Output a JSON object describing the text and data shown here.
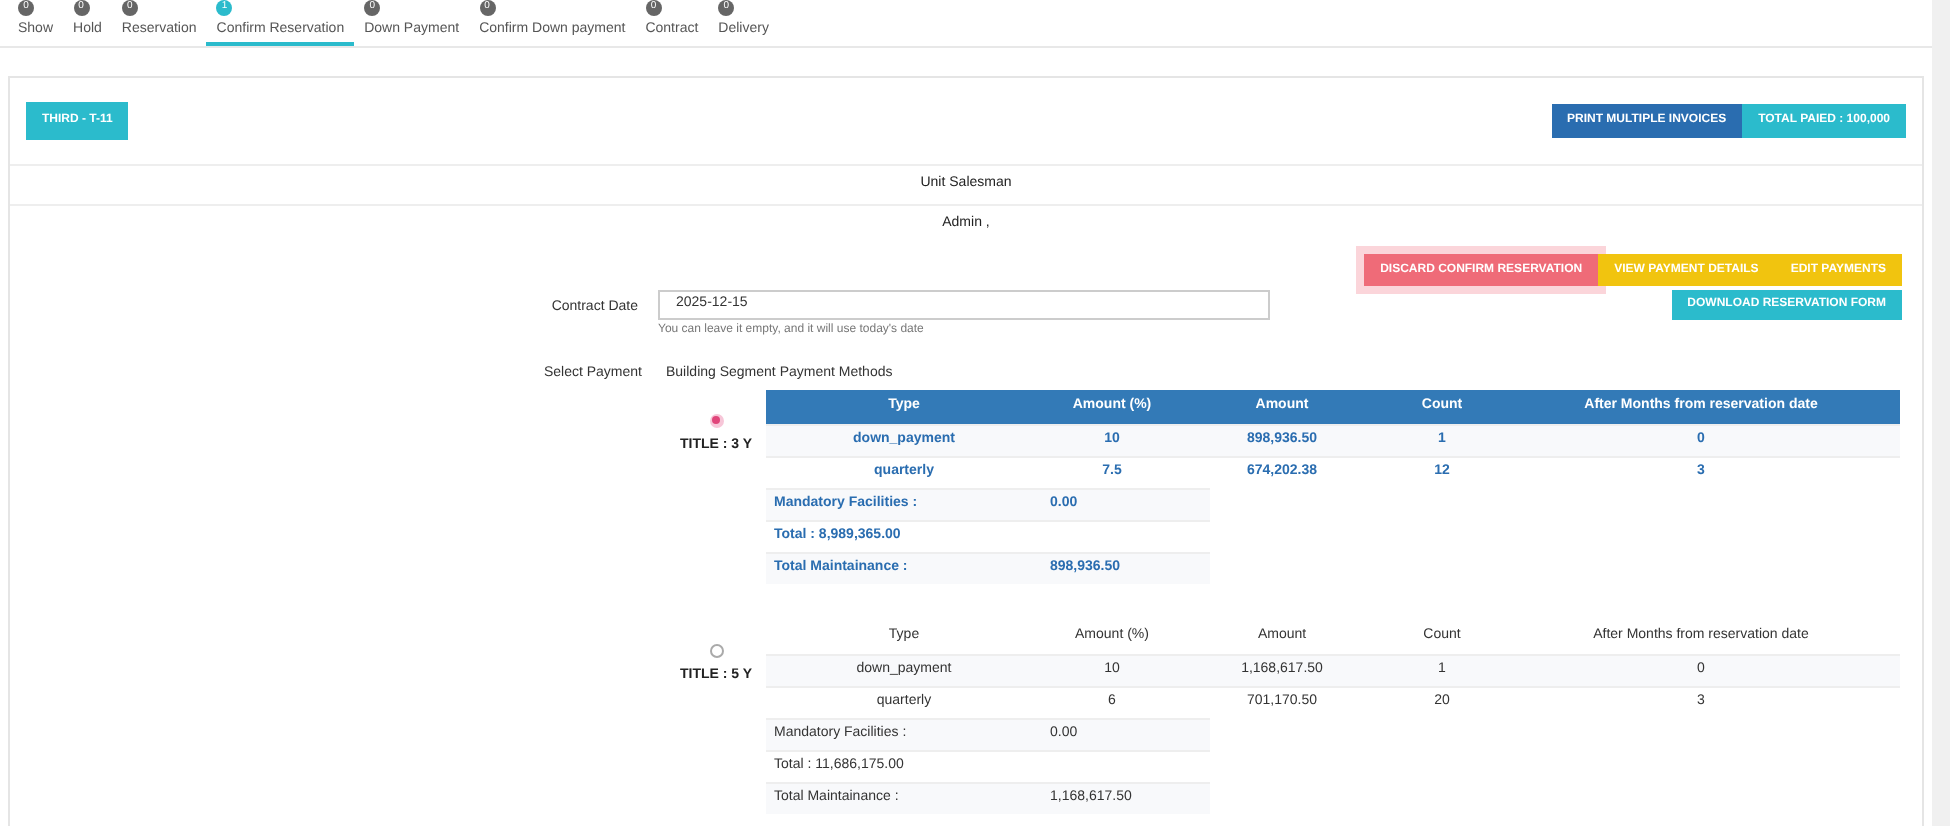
{
  "steps": [
    {
      "label": "Show",
      "count": "0",
      "selected": false
    },
    {
      "label": "Hold",
      "count": "0",
      "selected": false
    },
    {
      "label": "Reservation",
      "count": "0",
      "selected": false
    },
    {
      "label": "Confirm Reservation",
      "count": "1",
      "selected": true
    },
    {
      "label": "Down Payment",
      "count": "0",
      "selected": false
    },
    {
      "label": "Confirm Down payment",
      "count": "0",
      "selected": false
    },
    {
      "label": "Contract",
      "count": "0",
      "selected": false
    },
    {
      "label": "Delivery",
      "count": "0",
      "selected": false
    }
  ],
  "unit_button": "THIRD - T-11",
  "print_button": "PRINT MULTIPLE INVOICES",
  "total_paid": "TOTAL PAIED : 100,000",
  "salesman_heading": "Unit Salesman",
  "salesman": "Admin ,",
  "actions": [
    {
      "label": "DISCARD CONFIRM RESERVATION",
      "kind": "danger"
    },
    {
      "label": "VIEW PAYMENT DETAILS",
      "kind": "warning"
    },
    {
      "label": "EDIT PAYMENTS",
      "kind": "warning"
    }
  ],
  "download_button": "DOWNLOAD RESERVATION FORM",
  "contract_date": {
    "label": "Contract Date",
    "value": "2025-12-15",
    "help": "You can leave it empty, and it will use today's date"
  },
  "select_payment": {
    "label": "Select Payment",
    "heading": "Building Segment Payment Methods"
  },
  "plans": [
    {
      "title": "TITLE : 3 Y",
      "selected": true,
      "columns": [
        "Type",
        "Amount (%)",
        "Amount",
        "Count",
        "After Months from reservation date"
      ],
      "rows": [
        [
          "down_payment",
          "10",
          "898,936.50",
          "1",
          "0"
        ],
        [
          "quarterly",
          "7.5",
          "674,202.38",
          "12",
          "3"
        ]
      ],
      "summary": [
        {
          "label": "Mandatory Facilities :",
          "value": "0.00"
        },
        {
          "label": "Total : 8,989,365.00"
        },
        {
          "label": "Total Maintainance :",
          "value": "898,936.50"
        }
      ]
    },
    {
      "title": "TITLE : 5 Y",
      "selected": false,
      "columns": [
        "Type",
        "Amount (%)",
        "Amount",
        "Count",
        "After Months from reservation date"
      ],
      "rows": [
        [
          "down_payment",
          "10",
          "1,168,617.50",
          "1",
          "0"
        ],
        [
          "quarterly",
          "6",
          "701,170.50",
          "20",
          "3"
        ]
      ],
      "summary": [
        {
          "label": "Mandatory Facilities :",
          "value": "0.00"
        },
        {
          "label": "Total : 11,686,175.00"
        },
        {
          "label": "Total Maintainance :",
          "value": "1,168,617.50"
        }
      ]
    }
  ]
}
